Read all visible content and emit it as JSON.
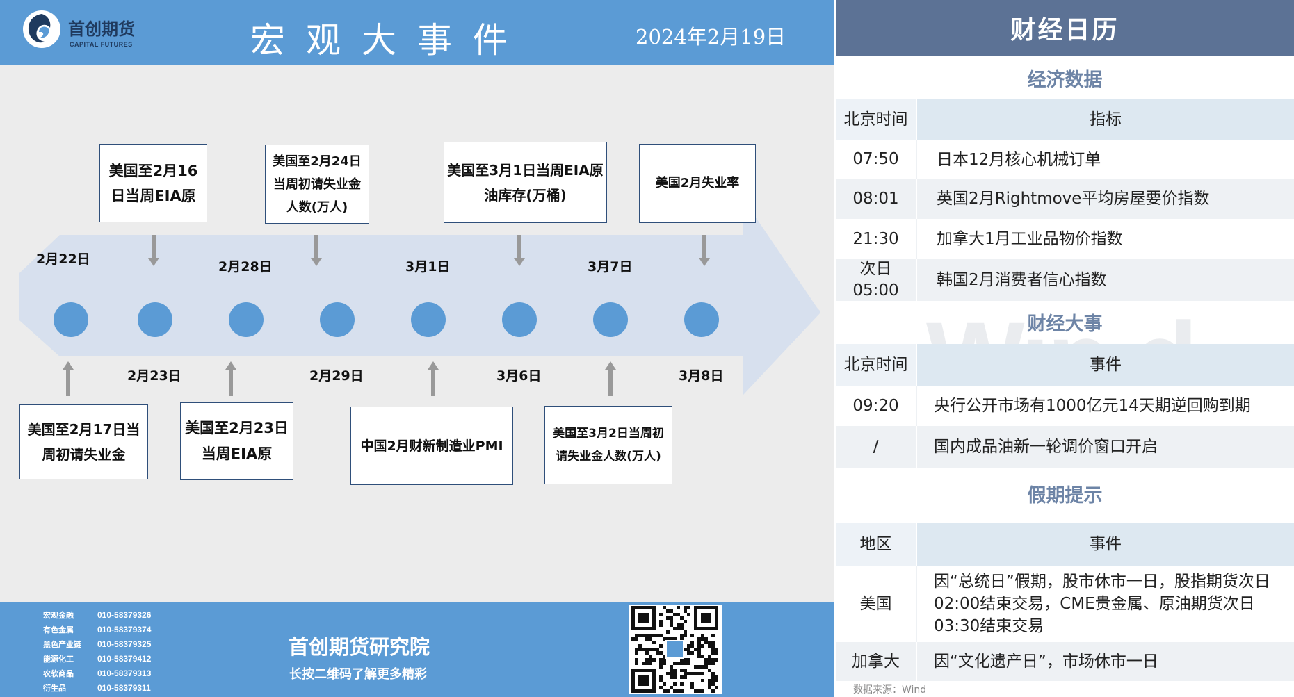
{
  "brand": {
    "name": "首创期货",
    "name_en": "CAPITAL FUTURES"
  },
  "header": {
    "title": "宏观大事件",
    "date": "2024年2月19日"
  },
  "timeline": {
    "dates_top": [
      "2月22日",
      "2月28日",
      "3月1日",
      "3月7日"
    ],
    "dates_bottom": [
      "2月23日",
      "2月29日",
      "3月6日",
      "3月8日"
    ],
    "events_top": [
      "美国至2月16日当周EIA原",
      "美国至2月24日当周初请失业金人数(万人)",
      "美国至3月1日当周EIA原油库存(万桶)",
      "美国2月失业率"
    ],
    "events_bottom": [
      "美国至2月17日当周初请失业金",
      "美国至2月23日当周EIA原",
      "中国2月财新制造业PMI",
      "美国至3月2日当周初请失业金人数(万人)"
    ],
    "colors": {
      "arrow": "#d7e0ee",
      "dot": "#5b9bd5",
      "pointer": "#999999"
    }
  },
  "footer": {
    "contacts": [
      {
        "name": "宏观金融",
        "phone": "010-58379326"
      },
      {
        "name": "有色金属",
        "phone": "010-58379374"
      },
      {
        "name": "黑色产业链",
        "phone": "010-58379325"
      },
      {
        "name": "能源化工",
        "phone": "010-58379412"
      },
      {
        "name": "农软商品",
        "phone": "010-58379313"
      },
      {
        "name": "衍生品",
        "phone": "010-58379311"
      }
    ],
    "institute": "首创期货研究院",
    "qr_hint": "长按二维码了解更多精彩"
  },
  "calendar": {
    "title": "财经日历",
    "econ": {
      "title": "经济数据",
      "headers": [
        "北京时间",
        "指标"
      ],
      "rows": [
        {
          "time": "07:50",
          "item": "日本12月核心机械订单"
        },
        {
          "time": "08:01",
          "item": "英国2月Rightmove平均房屋要价指数"
        },
        {
          "time": "21:30",
          "item": "加拿大1月工业品物价指数"
        },
        {
          "time": "次日\n05:00",
          "item": "韩国2月消费者信心指数"
        }
      ]
    },
    "events": {
      "title": "财经大事",
      "headers": [
        "北京时间",
        "事件"
      ],
      "rows": [
        {
          "time": "09:20",
          "item": "央行公开市场有1000亿元14天期逆回购到期"
        },
        {
          "time": "/",
          "item": "国内成品油新一轮调价窗口开启"
        }
      ]
    },
    "holidays": {
      "title": "假期提示",
      "headers": [
        "地区",
        "事件"
      ],
      "rows": [
        {
          "region": "美国",
          "item": "因“总统日”假期，股市休市一日，股指期货次日02:00结束交易，CME贵金属、原油期货次日03:30结束交易"
        },
        {
          "region": "加拿大",
          "item": "因“文化遗产日”，市场休市一日"
        }
      ]
    },
    "watermark": "Wind",
    "source": "数据来源：Wind"
  }
}
